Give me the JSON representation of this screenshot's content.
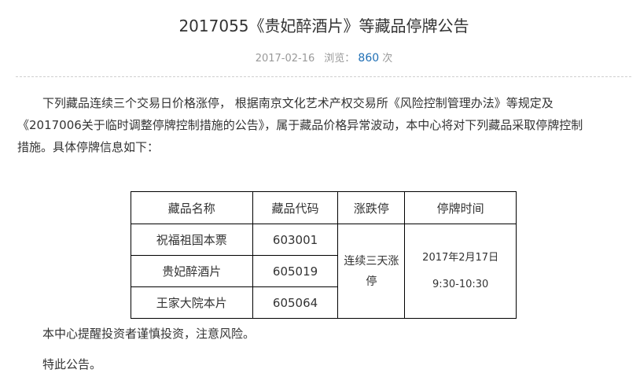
{
  "article": {
    "title": "2017055《贵妃醉酒片》等藏品停牌公告",
    "date": "2017-02-16",
    "views_label": "浏览：",
    "views_count": "860",
    "views_unit": "次"
  },
  "body": {
    "intro_lines": [
      "下列藏品连续三个交易日价格涨停， 根据南京文化艺术产权交易所《风险控制管理办法》等规定及",
      "《2017006关于临时调整停牌控制措施的公告》，属于藏品价格异常波动，本中心将对下列藏品采取停牌控制",
      "措施。具体停牌信息如下："
    ],
    "table": {
      "headers": [
        "藏品名称",
        "藏品代码",
        "涨跌停",
        "停牌时间"
      ],
      "rows": [
        {
          "name": "祝福祖国本票",
          "code": "603001"
        },
        {
          "name": "贵妃醉酒片",
          "code": "605019"
        },
        {
          "name": "王家大院本片",
          "code": "605064"
        }
      ],
      "limit_text": "连续三天涨停",
      "halt_date": "2017年2月17日",
      "halt_time": "9:30-10:30"
    },
    "reminder": "本中心提醒投资者谨慎投资，注意风险。",
    "closing": "特此公告。"
  }
}
